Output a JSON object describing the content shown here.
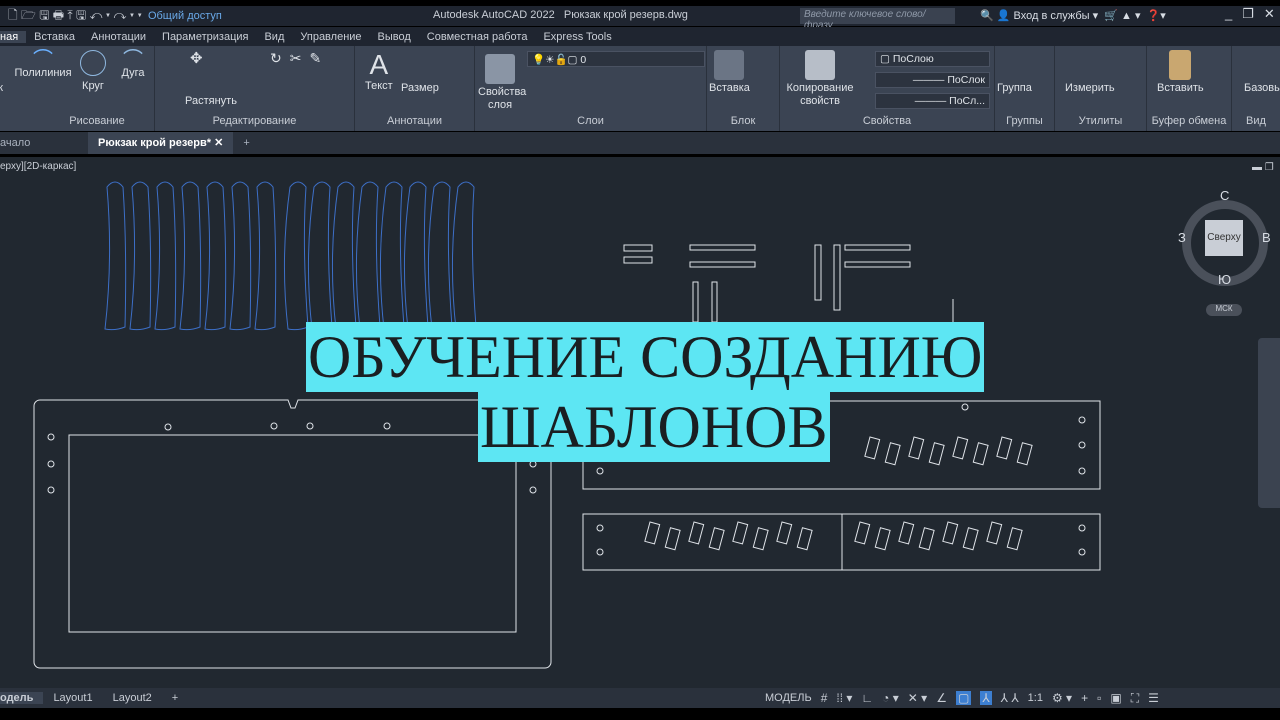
{
  "title_bar": {
    "share": "Общий доступ",
    "app_title": "Autodesk AutoCAD 2022",
    "file_name": "Рюкзак крой резерв.dwg",
    "search_placeholder": "Введите ключевое слово/фразу",
    "login": "Вход в службы"
  },
  "ribbon_tabs": [
    "ная",
    "Вставка",
    "Аннотации",
    "Параметризация",
    "Вид",
    "Управление",
    "Вывод",
    "Совместная работа",
    "Express Tools"
  ],
  "panels": {
    "draw": {
      "title": "Рисование",
      "tools": [
        "ок",
        "Полилиния",
        "Круг",
        "Дуга"
      ]
    },
    "modify": {
      "title": "Редактирование",
      "stretch": "Растянуть"
    },
    "annotation": {
      "title": "Аннотации",
      "tools": [
        "Текст",
        "Размер"
      ]
    },
    "layers": {
      "title": "Слои",
      "props": "Свойства",
      "props2": "слоя",
      "current_layer": "0"
    },
    "block": {
      "title": "Блок",
      "insert": "Вставка"
    },
    "properties": {
      "title": "Свойства",
      "match": "Копирование",
      "match2": "свойств",
      "color": "ПоСлою",
      "linetype": "ПоСлок",
      "lineweight": "ПоСл..."
    },
    "groups": {
      "title": "Группы",
      "group": "Группа"
    },
    "utilities": {
      "title": "Утилиты",
      "measure": "Измерить"
    },
    "clipboard": {
      "title": "Буфер обмена",
      "paste": "Вставить"
    },
    "view": {
      "title": "Вид",
      "base": "Базовы"
    }
  },
  "doc_tabs": {
    "start": "ачало",
    "current": "Рюкзак крой резерв*"
  },
  "viewport": {
    "label": "ерху][2D-каркас]",
    "viewcube": {
      "top": "Сверху",
      "n": "С",
      "s": "Ю",
      "w": "З",
      "e": "В",
      "ucs": "МСК"
    }
  },
  "overlay": {
    "line1": "ОБУЧЕНИЕ СОЗДАНИЮ",
    "line2": "ШАБЛОНОВ"
  },
  "layout_tabs": [
    "одель",
    "Layout1",
    "Layout2"
  ],
  "status": {
    "model": "МОДЕЛЬ",
    "scale": "1:1"
  }
}
